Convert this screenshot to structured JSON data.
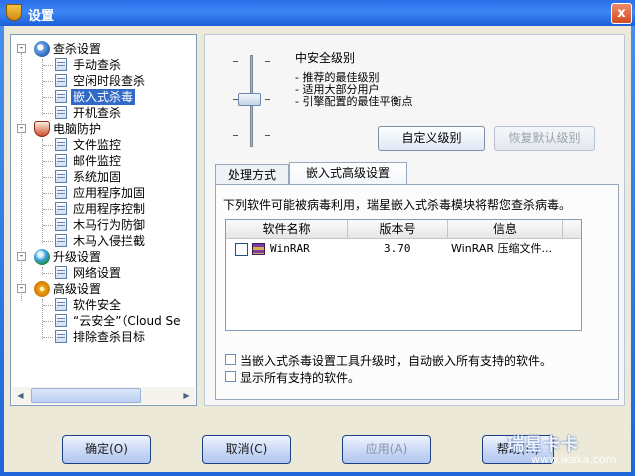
{
  "window": {
    "title": "设置",
    "close_label": "x"
  },
  "tree": {
    "groups": [
      {
        "label": "查杀设置",
        "toggle": "-",
        "children": [
          "手动查杀",
          "空闲时段查杀",
          "嵌入式杀毒",
          "开机查杀"
        ]
      },
      {
        "label": "电脑防护",
        "toggle": "-",
        "children": [
          "文件监控",
          "邮件监控",
          "系统加固",
          "应用程序加固",
          "应用程序控制",
          "木马行为防御",
          "木马入侵拦截"
        ]
      },
      {
        "label": "升级设置",
        "toggle": "-",
        "children": [
          "网络设置"
        ]
      },
      {
        "label": "高级设置",
        "toggle": "-",
        "children": [
          "软件安全",
          "“云安全”（Cloud Se",
          "排除查杀目标"
        ]
      }
    ],
    "selected": "嵌入式杀毒"
  },
  "security_level": {
    "title": "中安全级别",
    "descriptions": [
      "- 推荐的最佳级别",
      "- 适用大部分用户",
      "- 引擎配置的最佳平衡点"
    ],
    "custom_button": "自定义级别",
    "restore_button": "恢复默认级别"
  },
  "tabs": [
    {
      "label": "处理方式",
      "active": false
    },
    {
      "label": "嵌入式高级设置",
      "active": true
    }
  ],
  "embedded": {
    "info": "下列软件可能被病毒利用，瑞星嵌入式杀毒模块将帮您查杀病毒。",
    "columns": [
      "软件名称",
      "版本号",
      "信息"
    ],
    "rows": [
      {
        "name": "WinRAR",
        "version": "3.70",
        "info": "WinRAR 压缩文件...",
        "checked": false,
        "icon": "winrar-icon"
      }
    ],
    "option_auto_embed": "当嵌入式杀毒设置工具升级时，自动嵌入所有支持的软件。",
    "option_show_all": "显示所有支持的软件。"
  },
  "buttons": {
    "ok": "确定(O)",
    "cancel": "取消(C)",
    "apply": "应用(A)",
    "help": "帮助(H)"
  },
  "watermark": {
    "logo": "瑞星卡卡",
    "url": "www.ikaka.com"
  },
  "colors": {
    "titlebar": "#2a6ee8",
    "selection": "#316ac5",
    "client_bg": "#ece9d8"
  }
}
